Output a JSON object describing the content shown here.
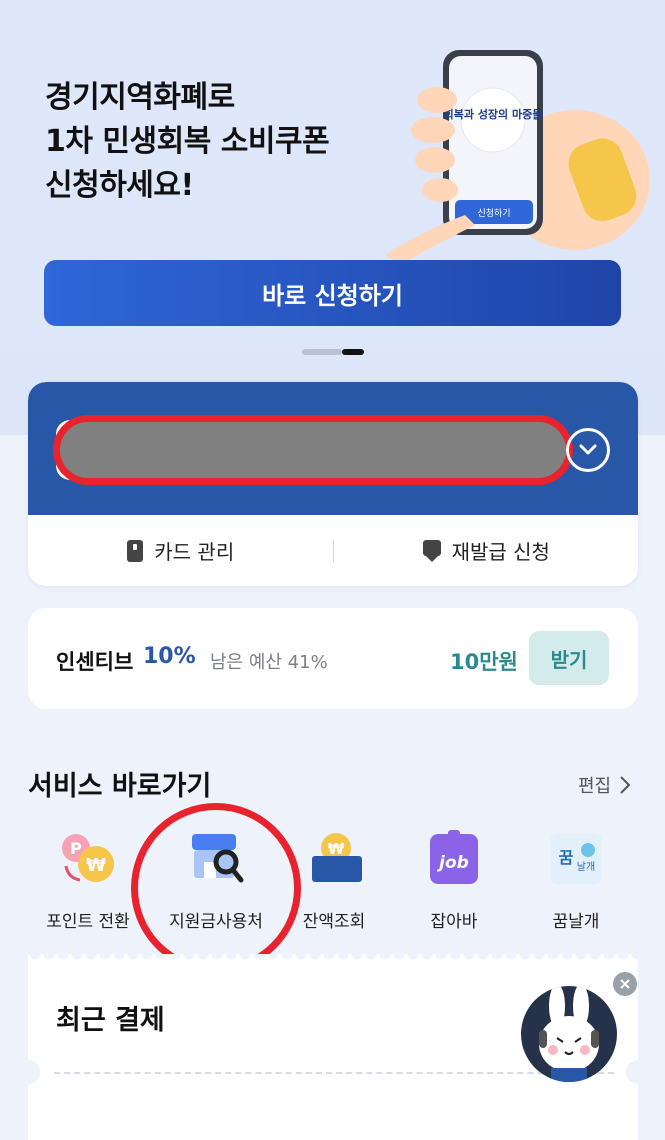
{
  "banner": {
    "title": "경기지역화폐로\n1차 민생회복 소비쿠폰\n신청하세요!",
    "phone_badge_text": "회복과 성장의 마중물",
    "phone_button_label": "신청하기",
    "apply_button_label": "바로 신청하기",
    "pager": {
      "current": 2,
      "total": 2
    }
  },
  "card": {
    "masked": true,
    "actions": [
      {
        "label": "카드 관리",
        "icon": "card-icon"
      },
      {
        "label": "재발급 신청",
        "icon": "reissue-icon"
      }
    ]
  },
  "incentive": {
    "label": "인센티브",
    "rate": "10%",
    "remaining": "남은 예산 41%",
    "amount": "10만원",
    "button_label": "받기"
  },
  "services": {
    "title": "서비스 바로가기",
    "edit_label": "편집",
    "items": [
      {
        "label": "포인트 전환",
        "icon": "point-convert-icon"
      },
      {
        "label": "지원금사용처",
        "icon": "store-search-icon"
      },
      {
        "label": "잔액조회",
        "icon": "balance-wallet-icon"
      },
      {
        "label": "잡아바",
        "icon": "job-icon"
      },
      {
        "label": "꿈날개",
        "icon": "dream-wings-icon"
      }
    ]
  },
  "recent": {
    "title": "최근 결제"
  },
  "colors": {
    "brand_blue": "#2857a8",
    "accent_teal": "#2a8a8f",
    "annotation_red": "#e8232d"
  }
}
